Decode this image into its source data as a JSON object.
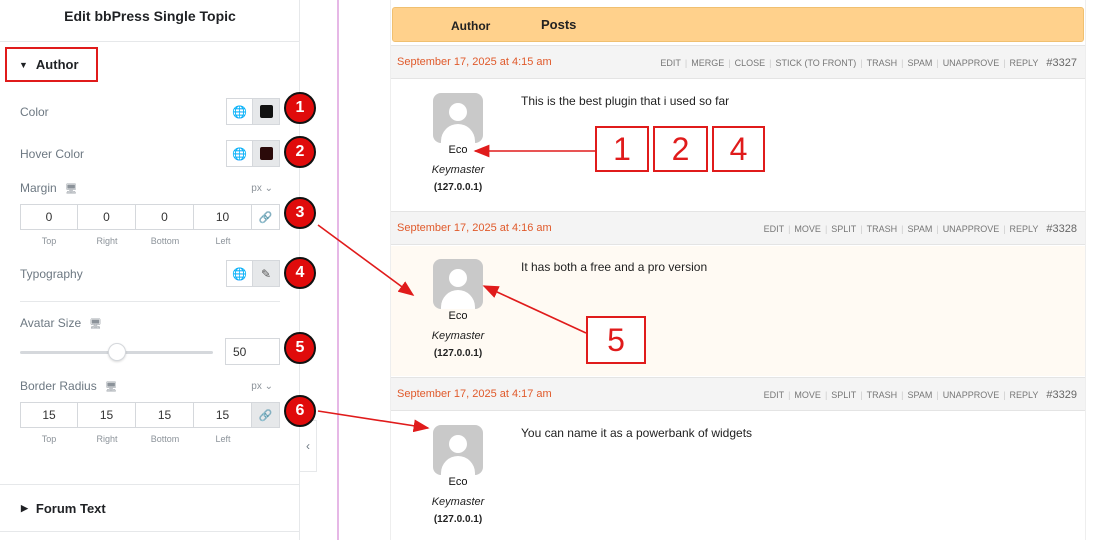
{
  "panel": {
    "title": "Edit bbPress Single Topic",
    "section_label": "Author",
    "color_label": "Color",
    "color_value": "#111111",
    "hover_color_label": "Hover Color",
    "hover_color_value": "#2b0a0a",
    "margin": {
      "label": "Margin",
      "unit": "px",
      "values": [
        "0",
        "0",
        "0",
        "10"
      ],
      "sides": [
        "Top",
        "Right",
        "Bottom",
        "Left"
      ]
    },
    "typography_label": "Typography",
    "avatar_size": {
      "label": "Avatar Size",
      "value": "50"
    },
    "border_radius": {
      "label": "Border Radius",
      "unit": "px",
      "values": [
        "15",
        "15",
        "15",
        "15"
      ],
      "sides": [
        "Top",
        "Right",
        "Bottom",
        "Left"
      ]
    },
    "forum_text_label": "Forum Text",
    "collapse_glyph": "‹"
  },
  "markers": [
    "1",
    "2",
    "3",
    "4",
    "5",
    "6"
  ],
  "callouts": [
    "1",
    "2",
    "4",
    "5"
  ],
  "forum": {
    "header_author": "Author",
    "header_posts": "Posts",
    "replies": [
      {
        "date": "September 17, 2025 at 4:15 am",
        "actions": [
          "EDIT",
          "MERGE",
          "CLOSE",
          "STICK (TO FRONT)",
          "TRASH",
          "SPAM",
          "UNAPPROVE",
          "REPLY"
        ],
        "id": "#3327",
        "author": "Eco",
        "role": "Keymaster",
        "ip": "(127.0.0.1)",
        "text": "This is the best plugin that i used so far"
      },
      {
        "date": "September 17, 2025 at 4:16 am",
        "actions": [
          "EDIT",
          "MOVE",
          "SPLIT",
          "TRASH",
          "SPAM",
          "UNAPPROVE",
          "REPLY"
        ],
        "id": "#3328",
        "author": "Eco",
        "role": "Keymaster",
        "ip": "(127.0.0.1)",
        "text": "It has both a free and a pro version"
      },
      {
        "date": "September 17, 2025 at 4:17 am",
        "actions": [
          "EDIT",
          "MOVE",
          "SPLIT",
          "TRASH",
          "SPAM",
          "UNAPPROVE",
          "REPLY"
        ],
        "id": "#3329",
        "author": "Eco",
        "role": "Keymaster",
        "ip": "(127.0.0.1)",
        "text": "You can name it as a powerbank of widgets"
      }
    ]
  },
  "colors": {
    "accent_red": "#e01b1b",
    "header_bg": "#ffd18c",
    "date_color": "#e05a2b"
  }
}
